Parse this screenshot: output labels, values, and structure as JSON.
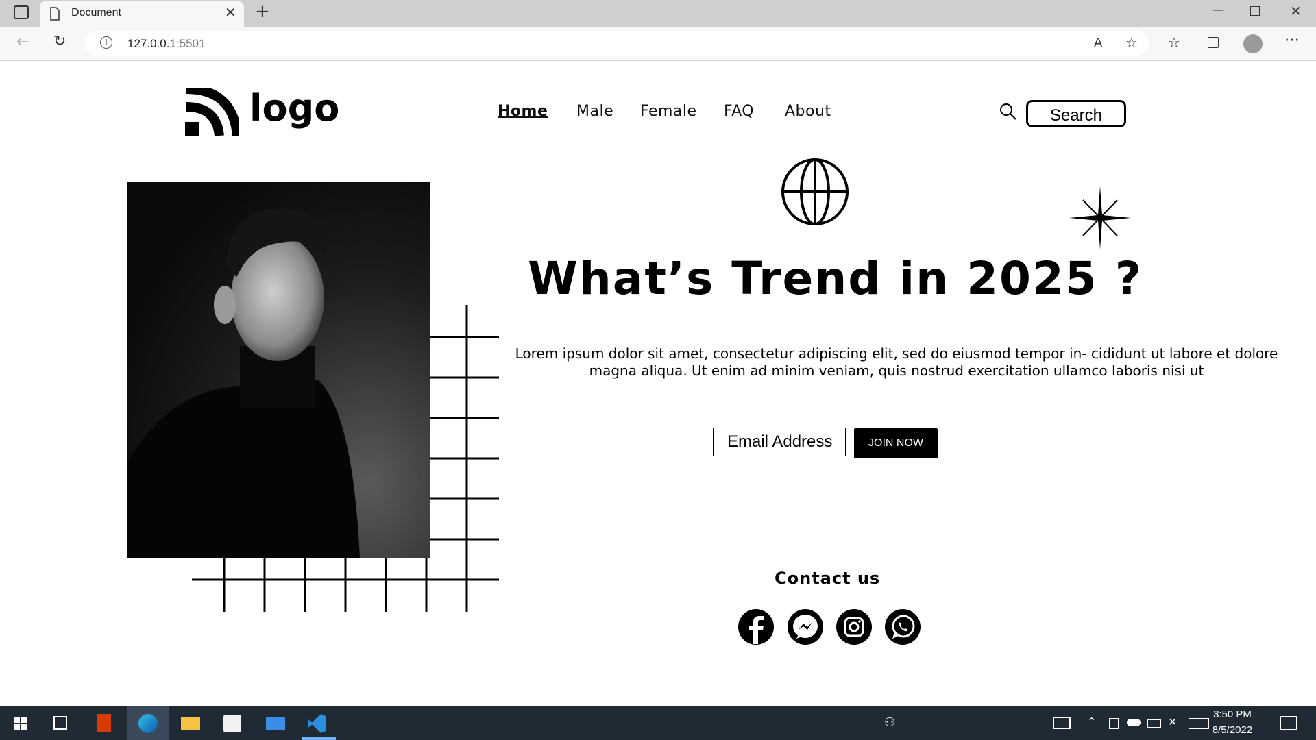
{
  "browser": {
    "tab_title": "Document",
    "url_host": "127.0.0.1",
    "url_port": ":5501"
  },
  "header": {
    "logo_text": "logo",
    "nav": [
      "Home",
      "Male",
      "Female",
      "FAQ",
      "About"
    ],
    "active_nav": "Home",
    "search_label": "Search"
  },
  "hero": {
    "title": "What’s Trend in 2025 ?",
    "text": "Lorem ipsum dolor sit amet, consectetur adipiscing elit, sed do eiusmod tempor in- cididunt ut labore et dolore magna aliqua. Ut enim ad minim veniam, quis nostrud exercitation ullamco laboris nisi ut",
    "email_placeholder": "Email Address",
    "join_label": "JOIN NOW"
  },
  "contact": {
    "title": "Contact us",
    "icons": [
      "facebook-icon",
      "messenger-icon",
      "instagram-icon",
      "whatsapp-icon"
    ]
  },
  "taskbar": {
    "time": "3:50 PM",
    "date": "8/5/2022"
  },
  "colors": {
    "accent": "#000000",
    "taskbar": "#1f2a35",
    "chrome": "#cfcfcf"
  }
}
